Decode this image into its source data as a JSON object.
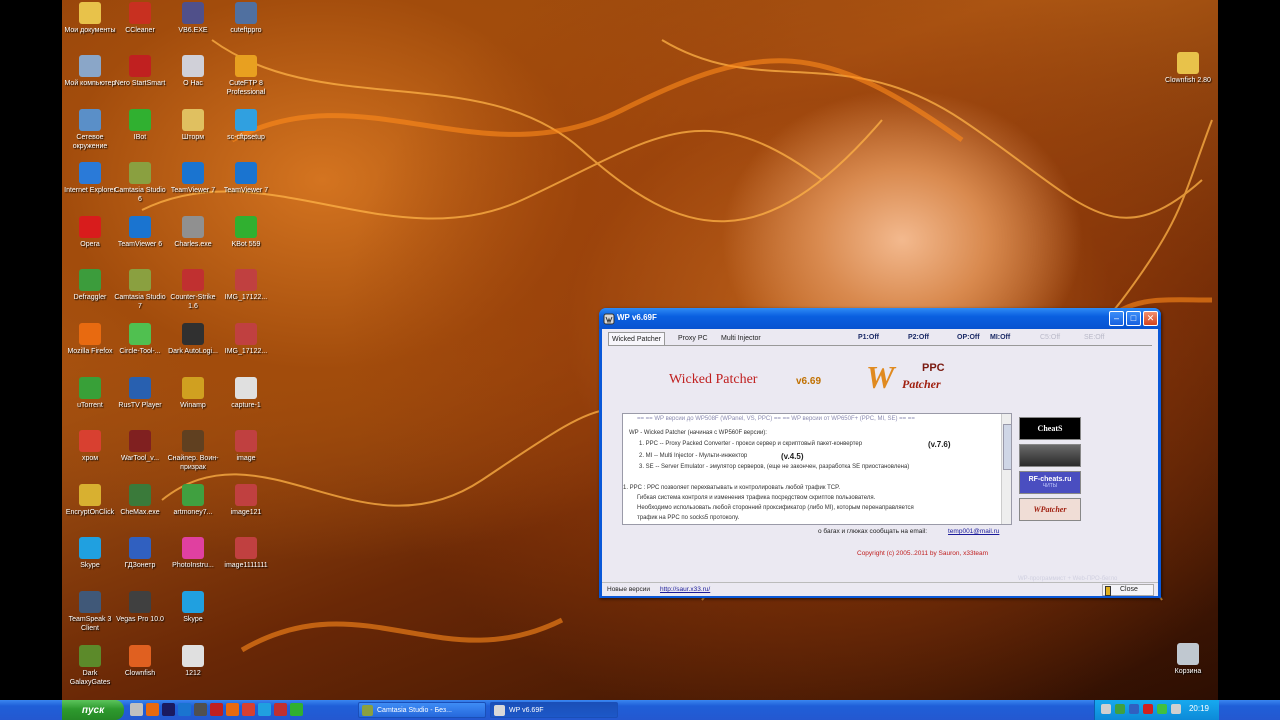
{
  "desktop": {
    "icons": [
      {
        "label": "Мои документы",
        "icon": "folder-documents-icon",
        "color": "#e8c24a"
      },
      {
        "label": "Мой компьютер",
        "icon": "computer-icon",
        "color": "#8aa6c8"
      },
      {
        "label": "Сетевое окружение",
        "icon": "network-icon",
        "color": "#5a8fc8"
      },
      {
        "label": "Internet Explorer",
        "icon": "ie-icon",
        "color": "#2a7ad8"
      },
      {
        "label": "Opera",
        "icon": "opera-icon",
        "color": "#d81c1c"
      },
      {
        "label": "Defraggler",
        "icon": "defraggler-icon",
        "color": "#3c9c3c"
      },
      {
        "label": "Mozilla Firefox",
        "icon": "firefox-icon",
        "color": "#e86a10"
      },
      {
        "label": "uTorrent",
        "icon": "utorrent-icon",
        "color": "#38a038"
      },
      {
        "label": "хром",
        "icon": "chrome-icon",
        "color": "#d84030"
      },
      {
        "label": "EncryptOnClick",
        "icon": "lock-icon",
        "color": "#d8b030"
      },
      {
        "label": "Skype",
        "icon": "skype-icon",
        "color": "#20a0e0"
      },
      {
        "label": "TeamSpeak 3 Client",
        "icon": "teamspeak-icon",
        "color": "#405878"
      },
      {
        "label": "Dark GalaxyGates",
        "icon": "game-icon",
        "color": "#5c8a2a"
      },
      {
        "label": "CCleaner",
        "icon": "ccleaner-icon",
        "color": "#c83020"
      },
      {
        "label": "Nero StartSmart",
        "icon": "nero-icon",
        "color": "#c02020"
      },
      {
        "label": "IBot",
        "icon": "ibot-icon",
        "color": "#30b030"
      },
      {
        "label": "Camtasia Studio 6",
        "icon": "camtasia-icon",
        "color": "#8aa040"
      },
      {
        "label": "TeamViewer 6",
        "icon": "teamviewer-icon",
        "color": "#1a74d0"
      },
      {
        "label": "Camtasia Studio 7",
        "icon": "camtasia-icon",
        "color": "#8aa040"
      },
      {
        "label": "Circle-Tool-...",
        "icon": "circle-icon",
        "color": "#50c050"
      },
      {
        "label": "RusTV Player",
        "icon": "tv-icon",
        "color": "#2860b0"
      },
      {
        "label": "WarTool_v...",
        "icon": "wartool-icon",
        "color": "#802020"
      },
      {
        "label": "CheMax.exe",
        "icon": "chemax-icon",
        "color": "#3a7a3a"
      },
      {
        "label": "ГДЗонетр",
        "icon": "gdz-icon",
        "color": "#3060c0"
      },
      {
        "label": "Vegas Pro 10.0",
        "icon": "vegas-icon",
        "color": "#404040"
      },
      {
        "label": "Clownfish",
        "icon": "clownfish-icon",
        "color": "#e06020"
      },
      {
        "label": "VB6.EXE",
        "icon": "vb-icon",
        "color": "#50508a"
      },
      {
        "label": "О Нас",
        "icon": "document-icon",
        "color": "#d0d0d8"
      },
      {
        "label": "Шторм",
        "icon": "file-icon",
        "color": "#e0c060"
      },
      {
        "label": "TeamViewer 7",
        "icon": "teamviewer-icon",
        "color": "#1a74d0"
      },
      {
        "label": "Charles.exe",
        "icon": "charles-icon",
        "color": "#909090"
      },
      {
        "label": "Counter-Strike 1.6",
        "icon": "cs-icon",
        "color": "#c03030"
      },
      {
        "label": "Dark AutoLogi...",
        "icon": "exe-icon",
        "color": "#303030"
      },
      {
        "label": "Winamp",
        "icon": "winamp-icon",
        "color": "#d0a020"
      },
      {
        "label": "Снайпер. Воин-призрак",
        "icon": "sniper-icon",
        "color": "#604020"
      },
      {
        "label": "artmoney7...",
        "icon": "artmoney-icon",
        "color": "#40a040"
      },
      {
        "label": "PhotoInstru...",
        "icon": "photo-icon",
        "color": "#e040a0"
      },
      {
        "label": "Skype",
        "icon": "skype-icon",
        "color": "#20a0e0"
      },
      {
        "label": "1212",
        "icon": "text-file-icon",
        "color": "#e0e0e0"
      },
      {
        "label": "cuteftppro",
        "icon": "ftp-icon",
        "color": "#5070a0"
      },
      {
        "label": "CuteFTP 8 Professional",
        "icon": "ftp-icon",
        "color": "#e8a020"
      },
      {
        "label": "sc-cftpsetup",
        "icon": "setup-icon",
        "color": "#30a0e0"
      },
      {
        "label": "TeamViewer 7",
        "icon": "teamviewer-icon",
        "color": "#1a74d0"
      },
      {
        "label": "KBot 559",
        "icon": "kbot-icon",
        "color": "#30b030"
      },
      {
        "label": "IMG_17122...",
        "icon": "image-icon",
        "color": "#c04040"
      },
      {
        "label": "IMG_17122...",
        "icon": "image-icon",
        "color": "#c04040"
      },
      {
        "label": "capture-1",
        "icon": "text-file-icon",
        "color": "#e0e0e0"
      },
      {
        "label": "image",
        "icon": "image-icon",
        "color": "#c04040"
      },
      {
        "label": "image121",
        "icon": "image-icon",
        "color": "#c04040"
      },
      {
        "label": "image1111111",
        "icon": "image-icon",
        "color": "#c04040"
      },
      {
        "label": "Clownfish 2.80",
        "icon": "folder-icon",
        "color": "#e8c24a"
      },
      {
        "label": "Корзина",
        "icon": "recycle-bin-icon",
        "color": "#c0c8d0"
      }
    ]
  },
  "window": {
    "title": "WP v6.69F",
    "tabs": [
      "Wicked Patcher",
      "Proxy PC",
      "Multi Injector"
    ],
    "status": [
      {
        "label": "P1:Off",
        "dim": false
      },
      {
        "label": "P2:Off",
        "dim": false
      },
      {
        "label": "OP:Off",
        "dim": false
      },
      {
        "label": "MI:Off",
        "dim": false
      },
      {
        "label": "C5:Off",
        "dim": true
      },
      {
        "label": "SE:Off",
        "dim": true
      }
    ],
    "app_name": "Wicked Patcher",
    "version": "v6.69",
    "logo_top": "PPC",
    "logo_script": "Patcher",
    "logo_letter": "W",
    "info_lines": [
      "== == WP версии до WP508F (WPanel, VS, PPC) == == WP версии от WP650F+ (PPC, MI, SE) == ==",
      "WP - Wicked Patcher (начиная с WP560F версии):",
      "1. PPC -- Proxy Packed Converter - прокси сервер и скриптовый пакет-конвертер",
      "(v.7.6)",
      "2. MI -- Multi Injector - Мульти-инжектор",
      "(v.4.5)",
      "3. SE -- Server Emulator - эмулятор серверов, (еще не закончен, разработка SE приостановлена)",
      "1. PPC : PPC позволяет перехватывать и контролировать любой трафик TCP.",
      "Гибкая система контроля и изменения трафика посредством скриптов пользователя.",
      "Необходимо использовать любой сторонний проксификатор (либо MI), которым перенаправляется",
      "трафик на PPC по socks5 протоколу."
    ],
    "side_buttons": [
      "CheatS",
      "",
      "RF-cheats.ru",
      "WPatcher"
    ],
    "side_sub": "ЧИТЫ",
    "contact_text": "о багах и глюках сообщать на email:",
    "contact_email": "temp001@mail.ru",
    "copyright": "Copyright (c) 2005..2011 by Sauron, x33team",
    "faint_note": "WP-программист + Web-ПРО-бегло",
    "new_versions_label": "Новые версии",
    "new_versions_url": "http://saur.x33.ru/",
    "close_label": "Close"
  },
  "taskbar": {
    "start_label": "пуск",
    "buttons": [
      "Camtasia Studio - Без...",
      "WP v6.69F"
    ],
    "clock": "20:19"
  }
}
